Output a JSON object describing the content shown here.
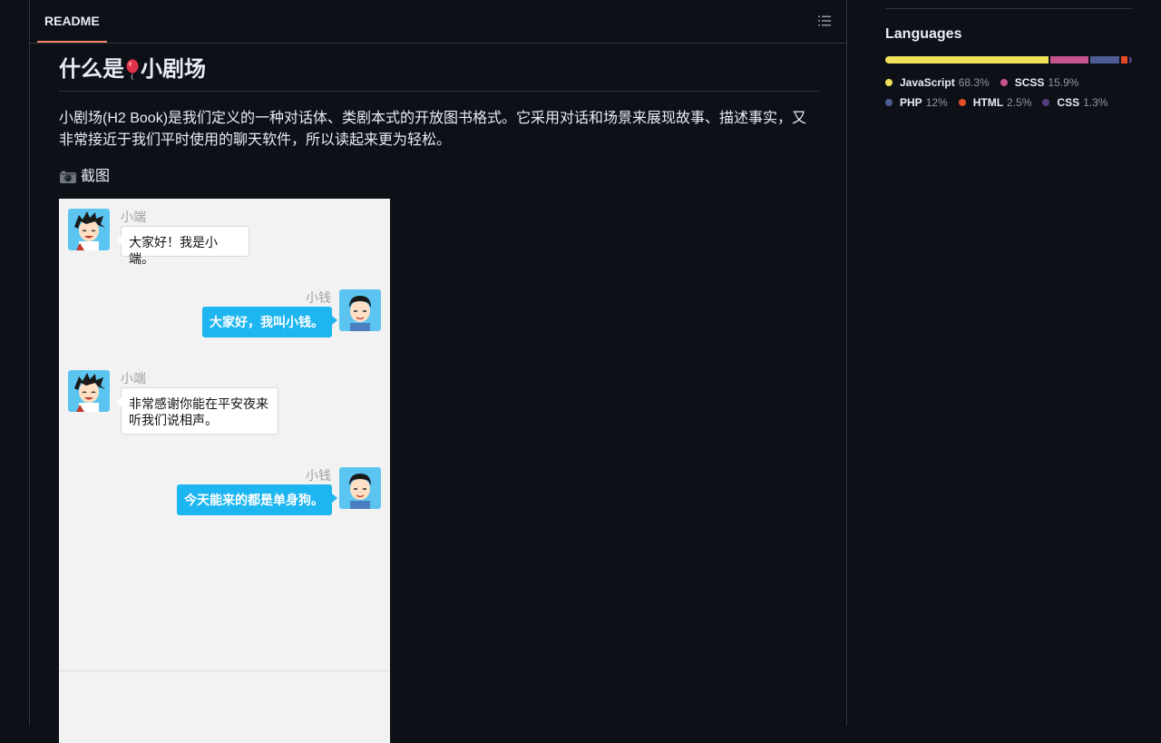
{
  "readme": {
    "tab_label": "README",
    "toc_icon": "list-unordered-icon",
    "title_before": "什么是",
    "title_emoji": "balloon-icon",
    "title_after": "小剧场",
    "paragraph": "小剧场(H2 Book)是我们定义的一种对话体、类剧本式的开放图书格式。它采用对话和场景来展现故事、描述事实，又非常接近于我们平时使用的聊天软件，所以读起来更为轻松。",
    "screenshot_heading_icon": "camera-icon",
    "screenshot_heading": "截图"
  },
  "chat": {
    "messages": [
      {
        "sender": "小端",
        "side": "left",
        "text": "大家好！我是小端。"
      },
      {
        "sender": "小钱",
        "side": "right",
        "text": "大家好，我叫小钱。"
      },
      {
        "sender": "小端",
        "side": "left",
        "text": "非常感谢你能在平安夜来听我们说相声。"
      },
      {
        "sender": "小钱",
        "side": "right",
        "text": "今天能来的都是单身狗。"
      }
    ]
  },
  "languages": {
    "title": "Languages",
    "items": [
      {
        "name": "JavaScript",
        "percent": "68.3%",
        "value": 68.3,
        "color": "#f1e05a"
      },
      {
        "name": "SCSS",
        "percent": "15.9%",
        "value": 15.9,
        "color": "#c6538c"
      },
      {
        "name": "PHP",
        "percent": "12%",
        "value": 12,
        "color": "#4f5d95"
      },
      {
        "name": "HTML",
        "percent": "2.5%",
        "value": 2.5,
        "color": "#e34c26"
      },
      {
        "name": "CSS",
        "percent": "1.3%",
        "value": 1.3,
        "color": "#563d7c"
      }
    ]
  }
}
